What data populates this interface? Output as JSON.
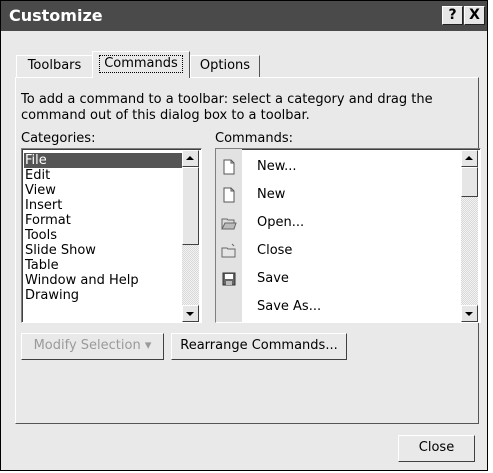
{
  "window": {
    "title": "Customize",
    "help_glyph": "?",
    "close_glyph": "X"
  },
  "tabs": [
    {
      "label": "Toolbars",
      "active": false
    },
    {
      "label": "Commands",
      "active": true
    },
    {
      "label": "Options",
      "active": false
    }
  ],
  "instructions": "To add a command to a toolbar: select a category and drag the command out of this dialog box to a toolbar.",
  "categories": {
    "label": "Categories:",
    "items": [
      "File",
      "Edit",
      "View",
      "Insert",
      "Format",
      "Tools",
      "Slide Show",
      "Table",
      "Window and Help",
      "Drawing"
    ],
    "selected": "File"
  },
  "commands": {
    "label": "Commands:",
    "items": [
      {
        "label": "New...",
        "icon": "blank-page-icon"
      },
      {
        "label": "New",
        "icon": "blank-page-icon"
      },
      {
        "label": "Open...",
        "icon": "open-folder-icon"
      },
      {
        "label": "Close",
        "icon": "close-folder-icon"
      },
      {
        "label": "Save",
        "icon": "floppy-disk-icon"
      },
      {
        "label": "Save As...",
        "icon": ""
      }
    ]
  },
  "buttons": {
    "modify_selection": "Modify Selection",
    "dropdown_arrow": "▾",
    "rearrange": "Rearrange Commands...",
    "close": "Close"
  }
}
